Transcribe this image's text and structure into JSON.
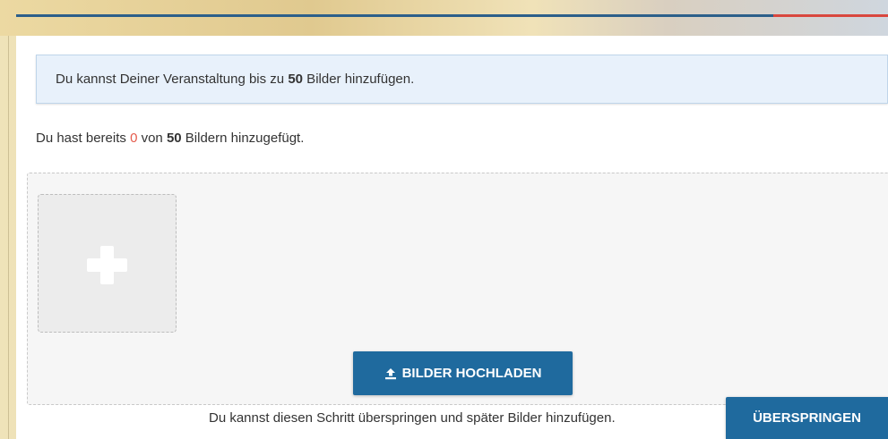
{
  "info": {
    "prefix": "Du kannst Deiner Veranstaltung bis zu ",
    "max": "50",
    "suffix": " Bilder hinzufügen."
  },
  "count": {
    "prefix": "Du hast bereits ",
    "current": "0",
    "middle": " von ",
    "max": "50",
    "suffix": " Bildern hinzugefügt."
  },
  "upload": {
    "label": "BILDER HOCHLADEN",
    "icon": "upload-icon"
  },
  "add_tile": {
    "icon": "plus-icon"
  },
  "skip": {
    "text": "Du kannst diesen Schritt überspringen und später Bilder hinzufügen.",
    "button_label": "ÜBERSPRINGEN"
  },
  "colors": {
    "primary_button": "#1f6a9e",
    "info_background": "#e8f1fb",
    "count_highlight": "#e55b4c",
    "accent_blue": "#2c5f8a",
    "accent_red": "#d9473e"
  }
}
